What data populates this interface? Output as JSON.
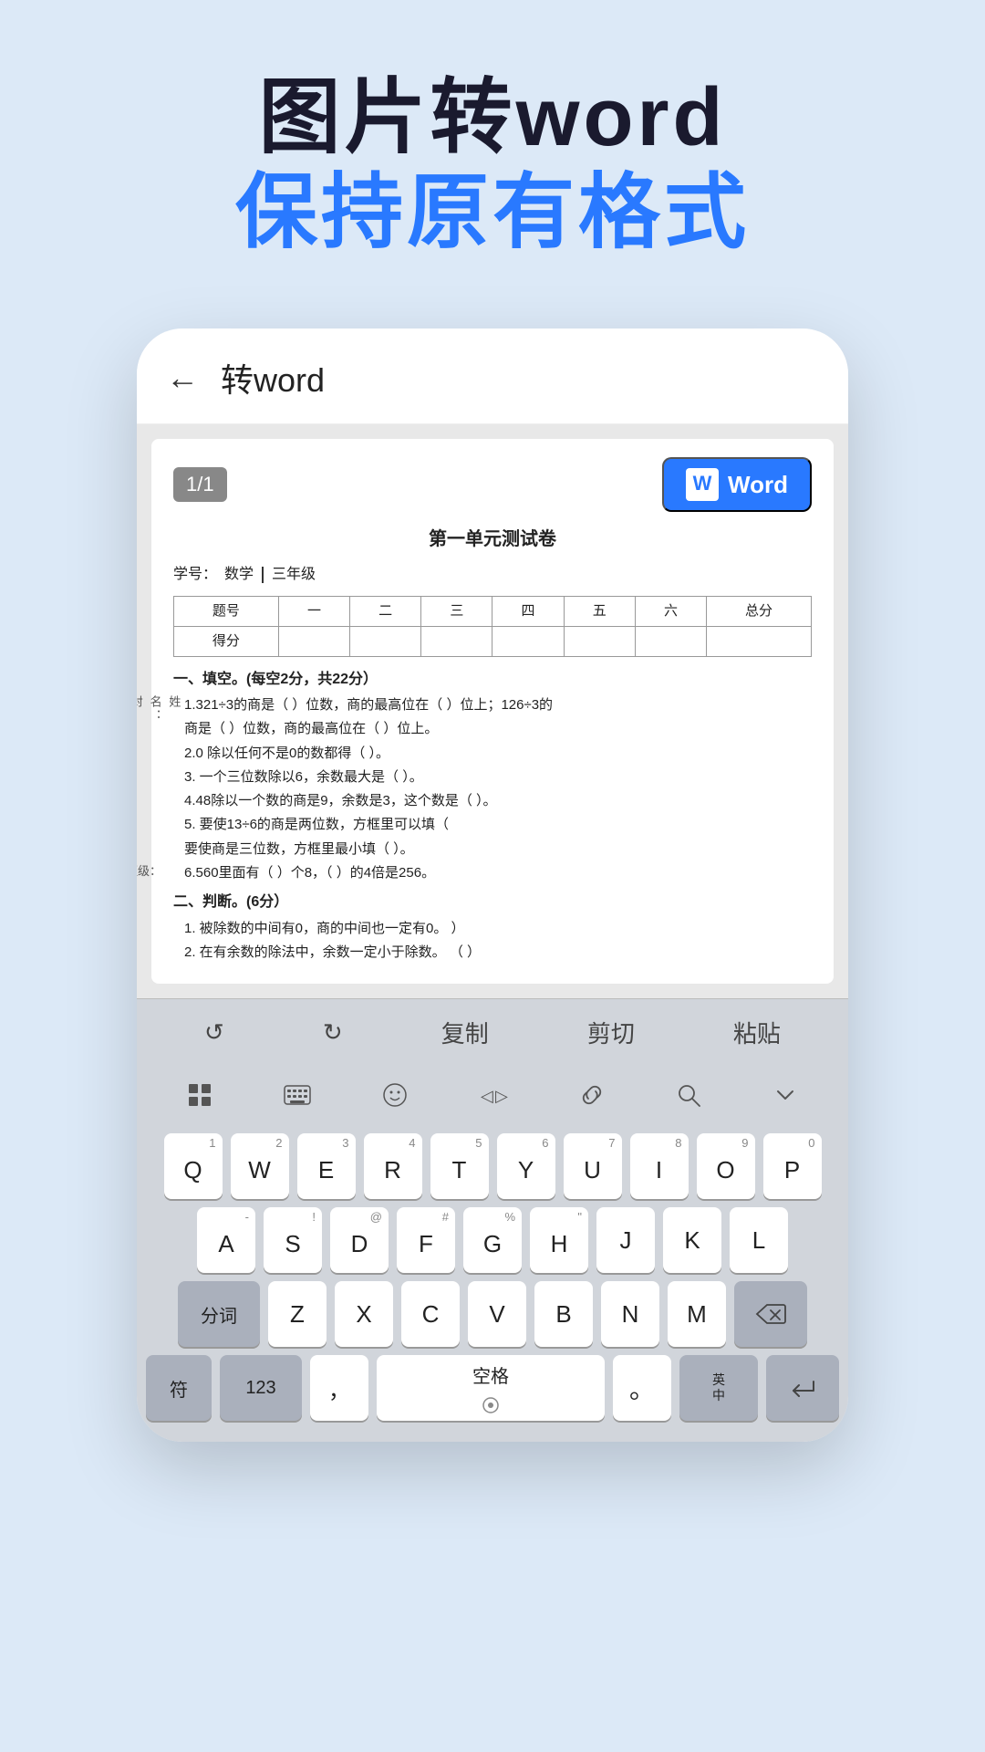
{
  "hero": {
    "line1": "图片转word",
    "line2_prefix": "保持",
    "line2_accent": "原有格式"
  },
  "appbar": {
    "title": "转word",
    "back_icon": "←"
  },
  "toolbar": {
    "page_indicator": "1/1",
    "word_button": "Word"
  },
  "document": {
    "title": "第一单元测试卷",
    "meta_label": "学号：",
    "meta_value": "数学",
    "meta_grade": "三年级",
    "table": {
      "headers": [
        "题号",
        "一",
        "二",
        "三",
        "四",
        "五",
        "六",
        "总分"
      ],
      "row2": [
        "得分",
        "",
        "",
        "",
        "",
        "",
        "",
        ""
      ]
    },
    "section1": "一、填空。(每空2分，共22分）",
    "paras": [
      "1.321÷3的商是（ ）位数，商的最高位在（ ）位上；126÷3的",
      "商是（ ）位数，商的最高位在（ ）位上。",
      "2.0 除以任何不是0的数都得（ ）。",
      "3. 一个三位数除以6，余数最大是（ ）。",
      "4.48除以一个数的商是9，余数是3，这个数是（ ）。",
      "5. 要使13÷6的商是两位数，方框里可以填（",
      "要使商是三位数，方框里最小填（ ）。",
      "6.560里面有（ ）个8，（ ）的4倍是256。"
    ],
    "section2": "二、判断。(6分）",
    "judge_paras": [
      "1. 被除数的中间有0，商的中间也一定有0。    ）",
      "2. 在有余数的除法中，余数一定小于除数。  （ ）"
    ],
    "aside_labels": [
      "姓名：",
      "封",
      "班级："
    ]
  },
  "kbd_toolbar": {
    "undo": "↺",
    "redo": "↻",
    "copy": "复制",
    "cut": "剪切",
    "paste": "粘贴"
  },
  "kbd_top": {
    "grid_icon": "▦",
    "keyboard_icon": "⌨",
    "emoji_icon": "☺",
    "cursor_icon": "◁▷",
    "link_icon": "⌀",
    "search_icon": "🔍",
    "collapse_icon": "∨"
  },
  "keyboard": {
    "row1": [
      {
        "main": "Q",
        "sub": "1"
      },
      {
        "main": "W",
        "sub": "2"
      },
      {
        "main": "E",
        "sub": "3"
      },
      {
        "main": "R",
        "sub": "4"
      },
      {
        "main": "T",
        "sub": "5"
      },
      {
        "main": "Y",
        "sub": "6"
      },
      {
        "main": "U",
        "sub": "7"
      },
      {
        "main": "I",
        "sub": "8"
      },
      {
        "main": "O",
        "sub": "9"
      },
      {
        "main": "P",
        "sub": "0"
      }
    ],
    "row2": [
      {
        "main": "A",
        "sub": "-"
      },
      {
        "main": "S",
        "sub": "!"
      },
      {
        "main": "D",
        "sub": "@"
      },
      {
        "main": "F",
        "sub": "#"
      },
      {
        "main": "G",
        "sub": "%"
      },
      {
        "main": "H",
        "sub": "\""
      },
      {
        "main": "J",
        "sub": ""
      },
      {
        "main": "K",
        "sub": ""
      },
      {
        "main": "L",
        "sub": ""
      }
    ],
    "row3_left": "分词",
    "row3": [
      {
        "main": "Z",
        "sub": ""
      },
      {
        "main": "X",
        "sub": ""
      },
      {
        "main": "C",
        "sub": ""
      },
      {
        "main": "V",
        "sub": ""
      },
      {
        "main": "B",
        "sub": ""
      },
      {
        "main": "N",
        "sub": ""
      },
      {
        "main": "M",
        "sub": ""
      }
    ],
    "row3_right": "⌫",
    "row4_fu": "符",
    "row4_123": "123",
    "row4_comma": "，",
    "row4_space": "空格",
    "row4_mic": "🎤",
    "row4_period": "。",
    "row4_enzh": "英\n中",
    "row4_enter": "↵"
  }
}
